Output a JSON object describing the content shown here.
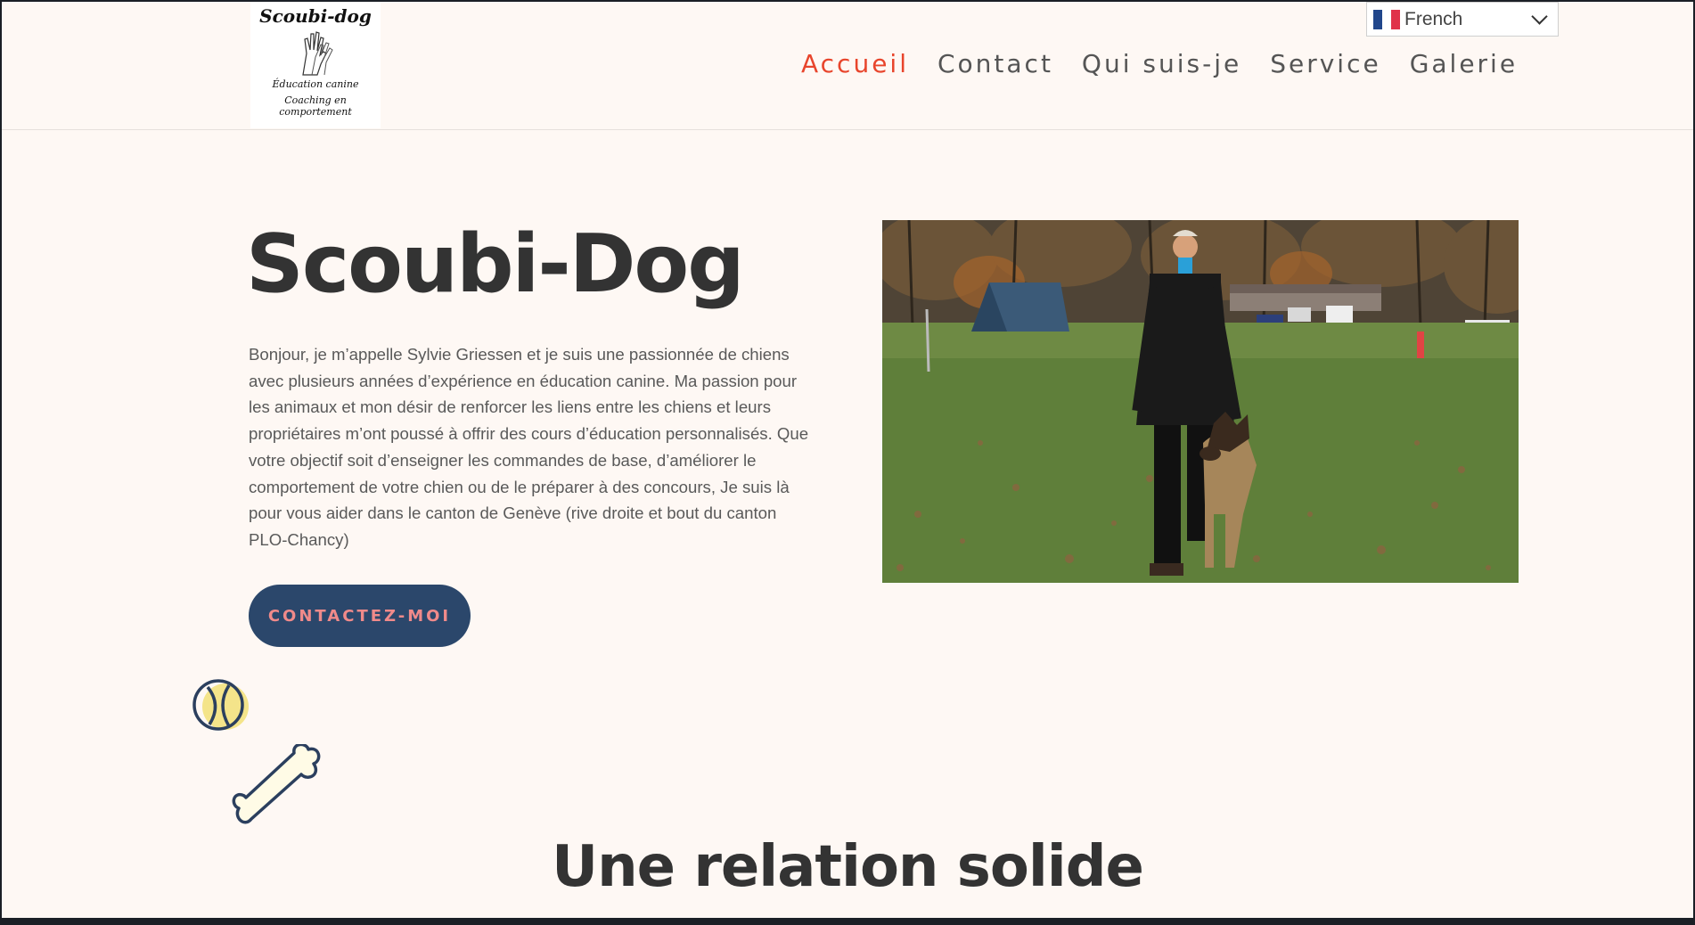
{
  "logo": {
    "title": "Scoubi-dog",
    "line1": "Éducation canine",
    "line2": "Coaching en comportement"
  },
  "nav": {
    "items": [
      {
        "label": "Accueil",
        "active": true
      },
      {
        "label": "Contact",
        "active": false
      },
      {
        "label": "Qui suis-je",
        "active": false
      },
      {
        "label": "Service",
        "active": false
      },
      {
        "label": "Galerie",
        "active": false
      }
    ]
  },
  "language": {
    "selected": "French",
    "flag_icon": "france-flag-icon"
  },
  "hero": {
    "title": "Scoubi-Dog",
    "text": "Bonjour, je m’appelle Sylvie Griessen et je suis une passionnée de chiens avec plusieurs années d’expérience en éducation canine. Ma passion pour les animaux et mon désir de renforcer les liens entre les chiens et leurs propriétaires m’ont poussé à offrir des cours d’éducation personnalisés. Que votre objectif soit d’enseigner les commandes de base, d’améliorer le comportement de votre chien ou de le préparer à des concours, Je suis là pour vous aider dans le canton de Genève (rive droite et bout du canton PLO-Chancy)",
    "cta_label": "CONTACTEZ-MOI"
  },
  "section": {
    "title": "Une relation solide"
  },
  "colors": {
    "background": "#fef8f4",
    "accent": "#e8452c",
    "button_bg": "#2b476b",
    "button_text": "#f08a8a",
    "heading": "#333333"
  }
}
